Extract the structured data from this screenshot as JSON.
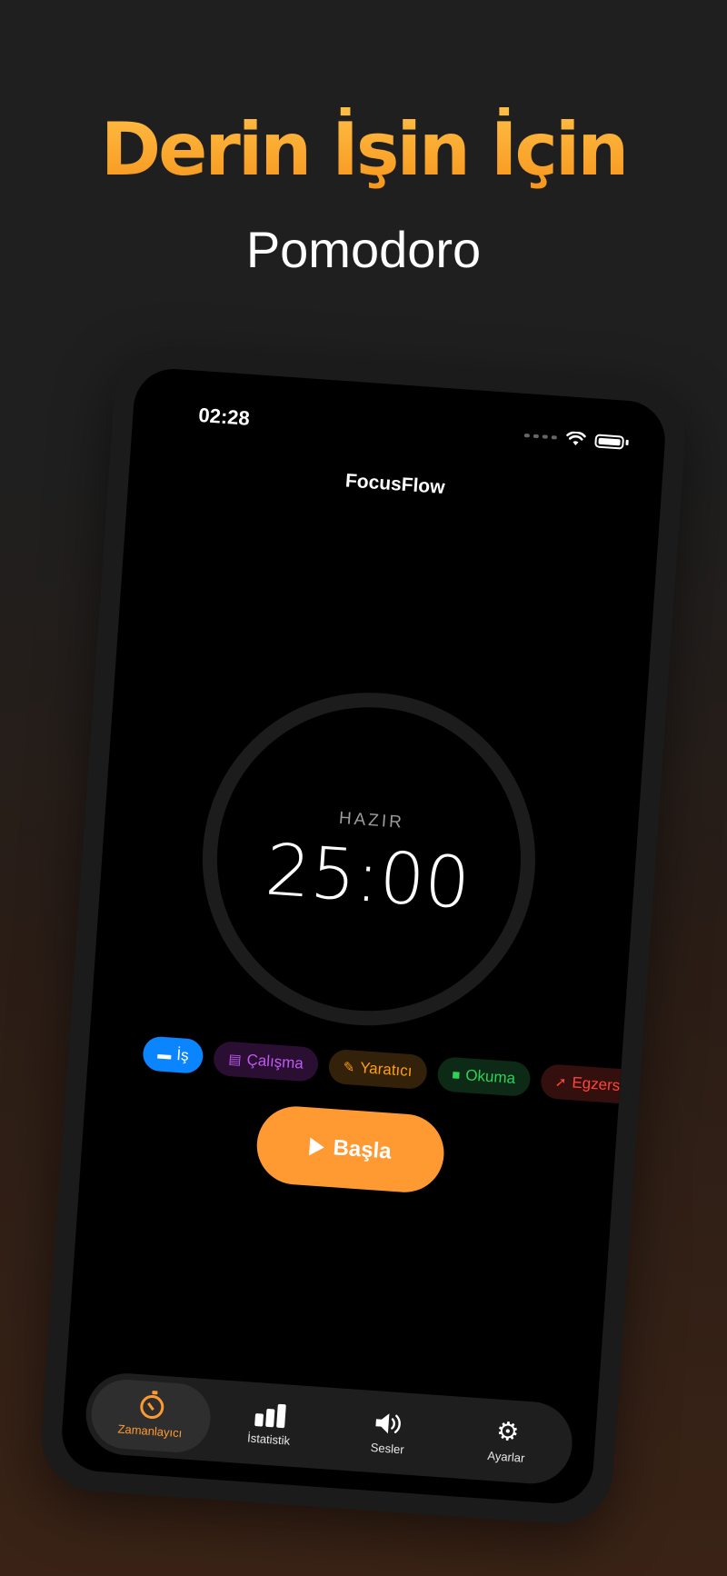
{
  "hero": {
    "headline": "Derin İşin İçin",
    "subheadline": "Pomodoro"
  },
  "status_bar": {
    "time": "02:28"
  },
  "app": {
    "title": "FocusFlow"
  },
  "timer": {
    "state": "HAZIR",
    "value": "25:00"
  },
  "categories": [
    {
      "label": "İş",
      "icon": "briefcase-icon",
      "color": "#0a84ff",
      "active": true
    },
    {
      "label": "Çalışma",
      "icon": "book-icon",
      "color": "#bf5af2",
      "active": false
    },
    {
      "label": "Yaratıcı",
      "icon": "brush-icon",
      "color": "#ff9f0a",
      "active": false
    },
    {
      "label": "Okuma",
      "icon": "book-closed-icon",
      "color": "#30d158",
      "active": false
    },
    {
      "label": "Egzersiz",
      "icon": "running-icon",
      "color": "#ff453a",
      "active": false
    }
  ],
  "start_button": {
    "label": "Başla"
  },
  "tabs": [
    {
      "label": "Zamanlayıcı",
      "icon": "stopwatch-icon",
      "active": true
    },
    {
      "label": "İstatistik",
      "icon": "bar-chart-icon",
      "active": false
    },
    {
      "label": "Sesler",
      "icon": "speaker-icon",
      "active": false
    },
    {
      "label": "Ayarlar",
      "icon": "gear-icon",
      "active": false
    }
  ],
  "colors": {
    "accent": "#ff9a33",
    "headline_gradient_top": "#ffbe45",
    "headline_gradient_bottom": "#f6951c"
  }
}
